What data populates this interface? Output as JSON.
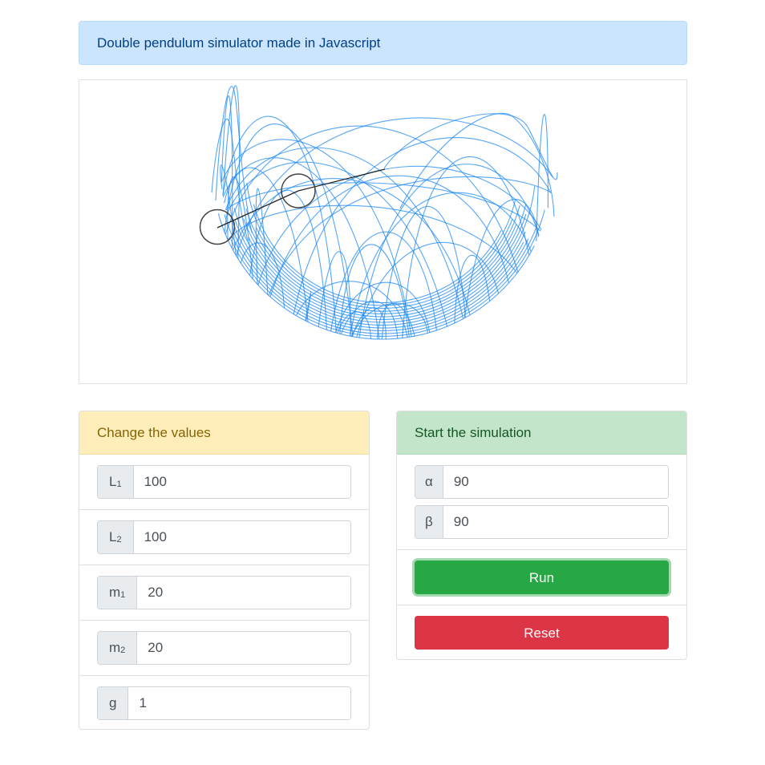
{
  "header": {
    "title": "Double pendulum simulator made in Javascript"
  },
  "simulation": {
    "trace_color": "#1e88f5",
    "arm_color": "#222222"
  },
  "values_card": {
    "title": "Change the values",
    "fields": [
      {
        "prefix": "L",
        "sub": "1",
        "value": "100"
      },
      {
        "prefix": "L",
        "sub": "2",
        "value": "100"
      },
      {
        "prefix": "m",
        "sub": "1",
        "value": "20"
      },
      {
        "prefix": "m",
        "sub": "2",
        "value": "20"
      },
      {
        "prefix": "g",
        "sub": "",
        "value": "1"
      }
    ]
  },
  "start_card": {
    "title": "Start the simulation",
    "alpha": {
      "label": "α",
      "value": "90"
    },
    "beta": {
      "label": "β",
      "value": "90"
    },
    "run_label": "Run",
    "reset_label": "Reset"
  },
  "colors": {
    "info_bg": "#cce5ff",
    "warning_bg": "#ffeeba",
    "success_bg": "#c3e6cb",
    "run": "#28a745",
    "reset": "#dc3545"
  }
}
